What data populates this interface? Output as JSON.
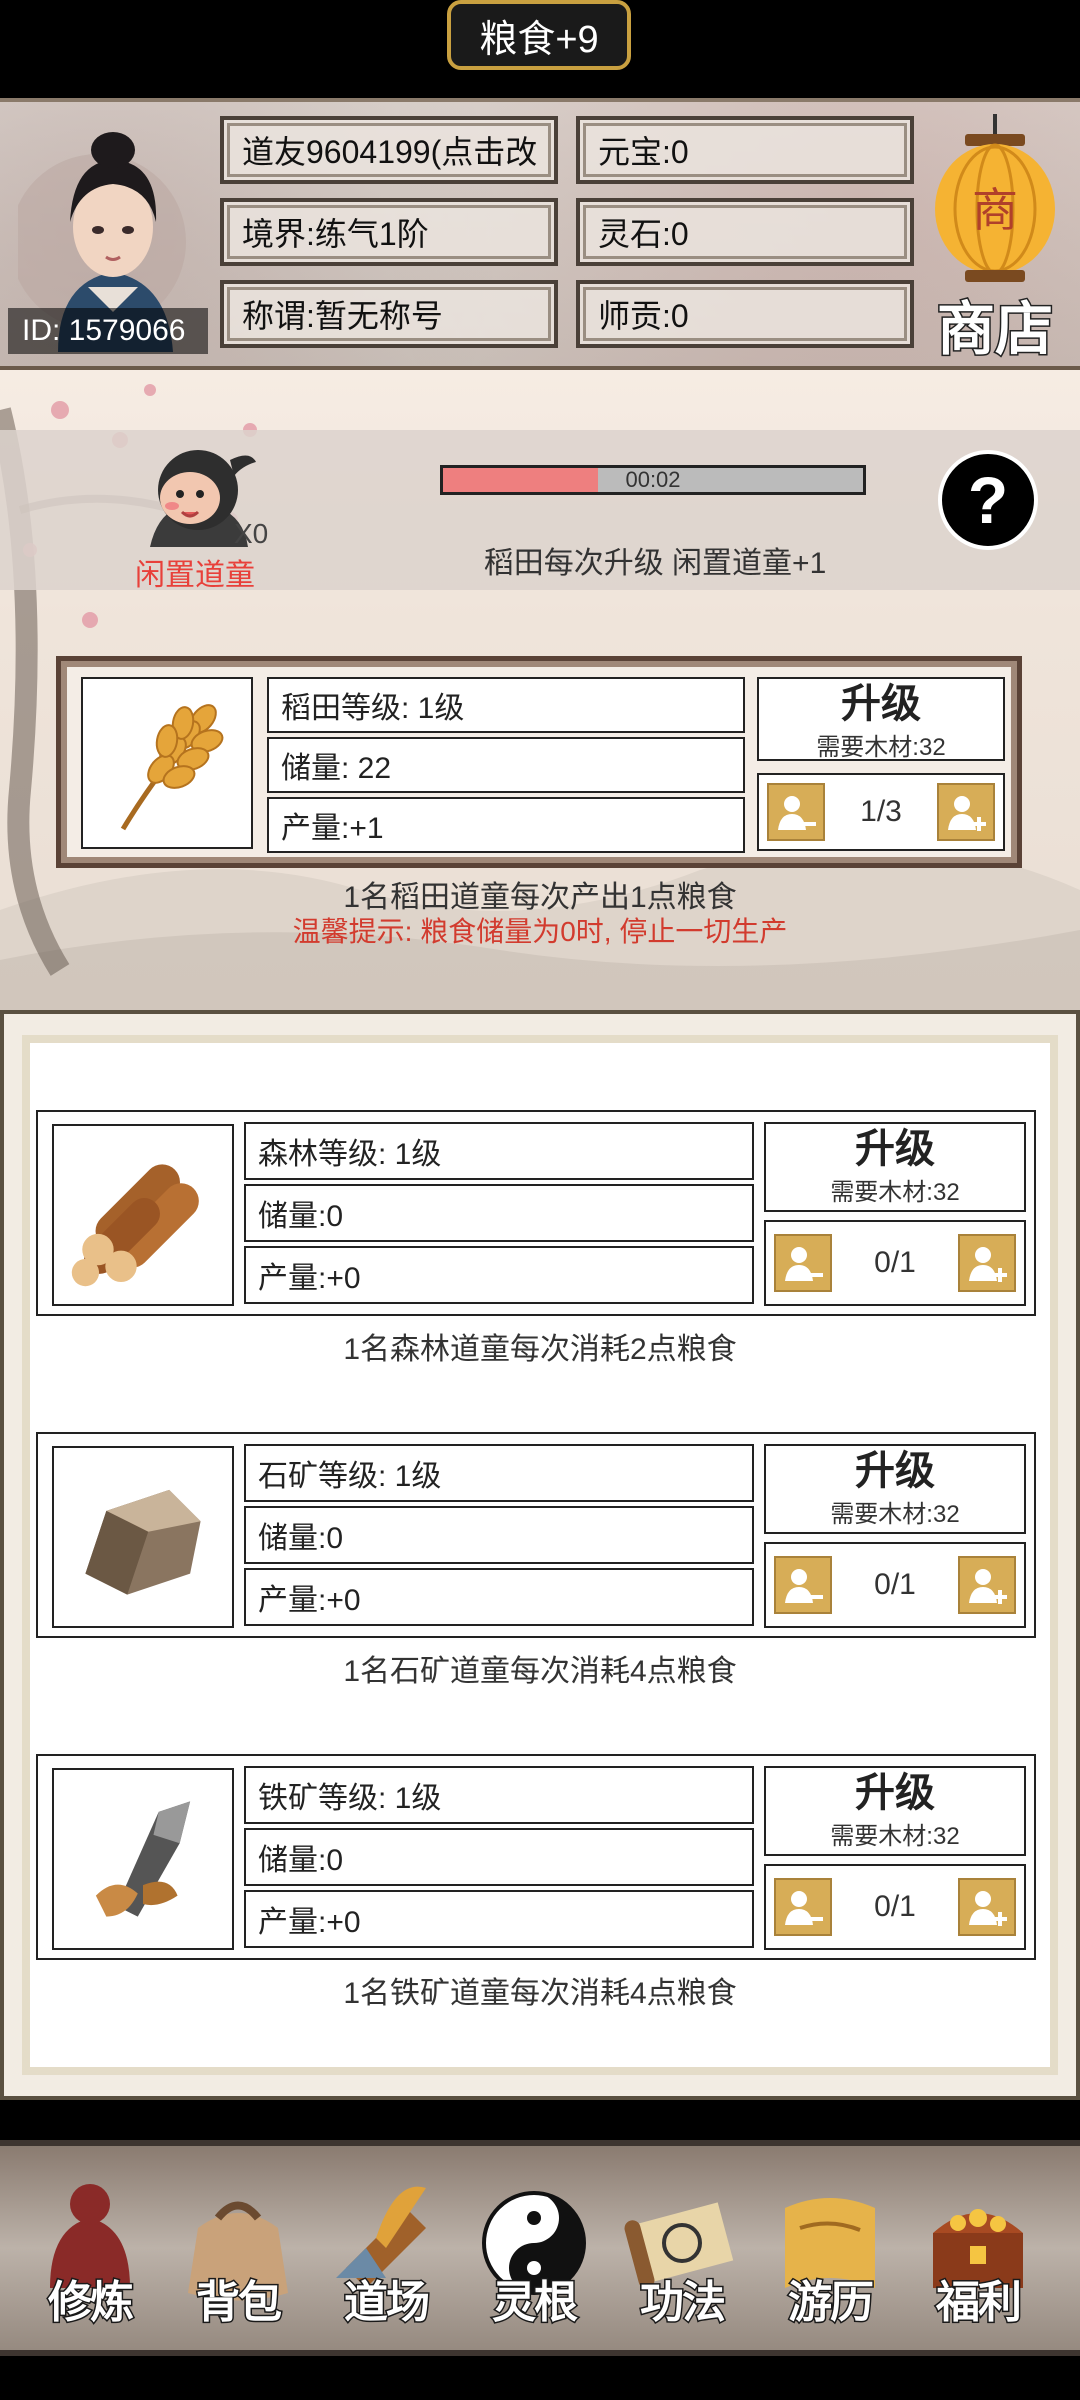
{
  "toast": "粮食+9",
  "header": {
    "player_name": "道友9604199(点击改",
    "realm": "境界:练气1阶",
    "title": "称谓:暂无称号",
    "yuanbao": "元宝:0",
    "lingshi": "灵石:0",
    "shigong": "师贡:0",
    "id": "ID: 1579066",
    "shop_label": "商店",
    "shop_lantern_char": "商"
  },
  "idle": {
    "count": "X0",
    "label": "闲置道童",
    "timer": "00:02",
    "progress": 0.37,
    "tip": "稻田每次升级 闲置道童+1",
    "help": "?"
  },
  "farm": {
    "level": "稻田等级: 1级",
    "storage": "储量: 22",
    "output": "产量:+1",
    "upgrade": "升级",
    "cost": "需要木材:32",
    "workers": "1/3",
    "desc": "1名稻田道童每次产出1点粮食",
    "warning": "温馨提示: 粮食储量为0时, 停止一切生产"
  },
  "resources": [
    {
      "icon": "wood-logs-icon",
      "level": "森林等级: 1级",
      "storage": "储量:0",
      "output": "产量:+0",
      "upgrade": "升级",
      "cost": "需要木材:32",
      "workers": "0/1",
      "desc": "1名森林道童每次消耗2点粮食"
    },
    {
      "icon": "stone-ore-icon",
      "level": "石矿等级: 1级",
      "storage": "储量:0",
      "output": "产量:+0",
      "upgrade": "升级",
      "cost": "需要木材:32",
      "workers": "0/1",
      "desc": "1名石矿道童每次消耗4点粮食"
    },
    {
      "icon": "iron-ore-icon",
      "level": "铁矿等级: 1级",
      "storage": "储量:0",
      "output": "产量:+0",
      "upgrade": "升级",
      "cost": "需要木材:32",
      "workers": "0/1",
      "desc": "1名铁矿道童每次消耗4点粮食"
    }
  ],
  "nav": [
    {
      "label": "修炼",
      "icon": "cultivation-icon"
    },
    {
      "label": "背包",
      "icon": "backpack-icon"
    },
    {
      "label": "道场",
      "icon": "dojo-icon"
    },
    {
      "label": "灵根",
      "icon": "yin-yang-icon"
    },
    {
      "label": "功法",
      "icon": "scroll-icon"
    },
    {
      "label": "游历",
      "icon": "map-icon"
    },
    {
      "label": "福利",
      "icon": "treasure-chest-icon"
    }
  ],
  "colors": {
    "gold": "#d7ad57",
    "progress": "#ee7f7f",
    "warning": "#d23b2e",
    "idle_label": "#e8403a"
  }
}
